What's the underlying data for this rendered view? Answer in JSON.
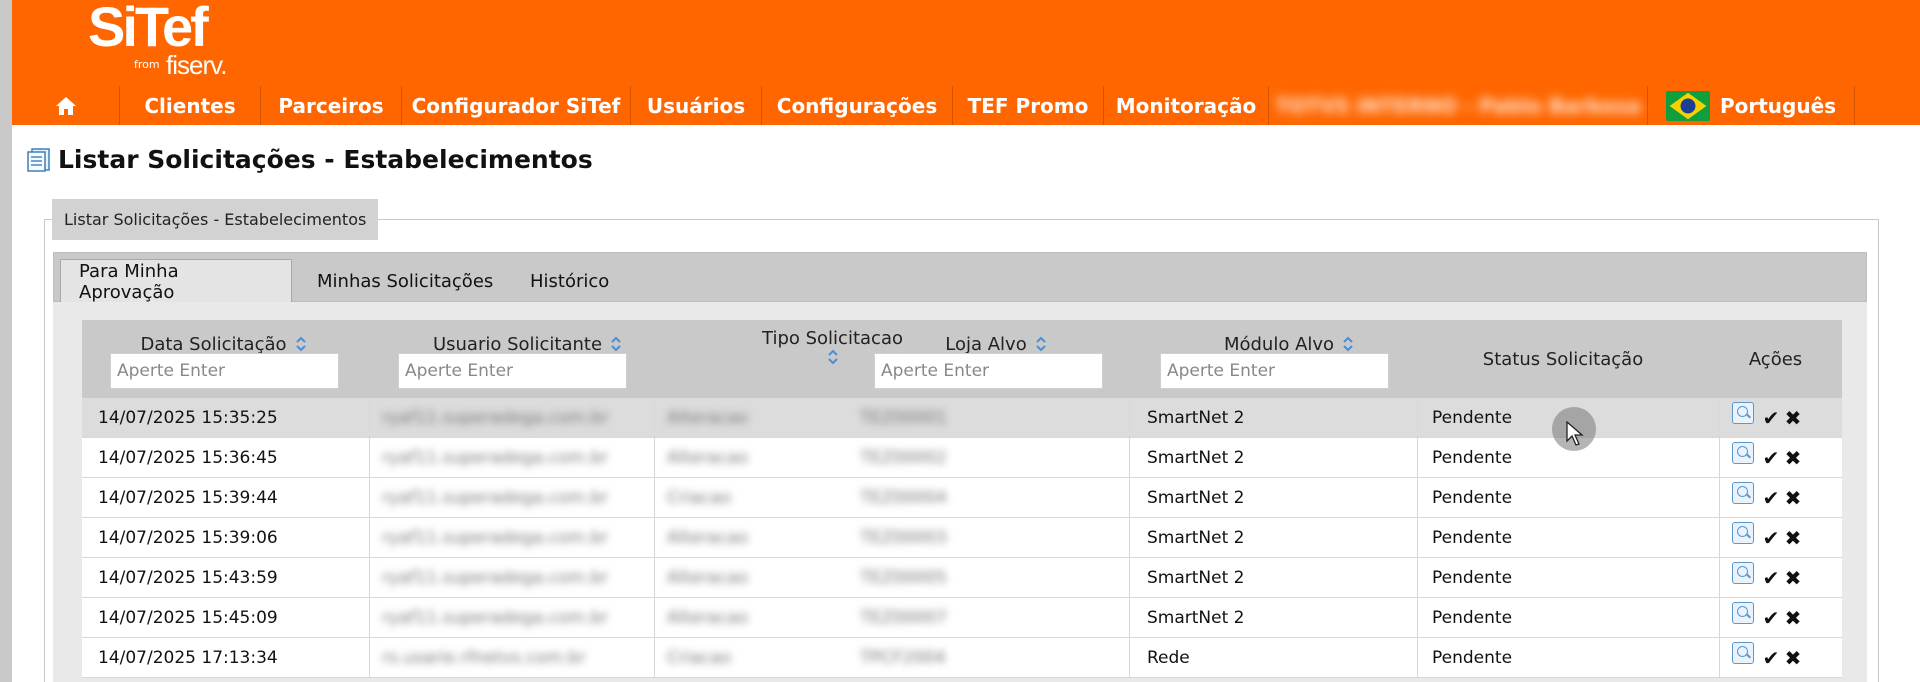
{
  "app": {
    "logo": {
      "name": "SiTef",
      "from": "from",
      "brand": "fiserv."
    },
    "accent_color": "#ff6600"
  },
  "nav": {
    "home_icon": "home-icon",
    "items": [
      "Clientes",
      "Parceiros",
      "Configurador SiTef",
      "Usuários",
      "Configurações",
      "TEF Promo",
      "Monitoração"
    ],
    "user": "TOTVS INTERNO - Pablo Barbosa",
    "language": "Português",
    "language_flag": "brazil-flag-icon"
  },
  "page": {
    "title": "Listar Solicitações - Estabelecimentos",
    "panel_legend": "Listar Solicitações - Estabelecimentos"
  },
  "tabs": [
    {
      "label": "Para Minha Aprovação",
      "active": true
    },
    {
      "label": "Minhas Solicitações",
      "active": false
    },
    {
      "label": "Histórico",
      "active": false
    }
  ],
  "table": {
    "columns": [
      {
        "label": "Data Solicitação",
        "placeholder": "Aperte Enter"
      },
      {
        "label": "Usuario Solicitante",
        "placeholder": "Aperte Enter"
      },
      {
        "label": "Tipo Solicitacao"
      },
      {
        "label": "Loja Alvo",
        "placeholder": "Aperte Enter"
      },
      {
        "label": "Módulo Alvo",
        "placeholder": "Aperte Enter"
      },
      {
        "label": "Status Solicitação"
      },
      {
        "label": "Ações"
      }
    ],
    "rows": [
      {
        "date": "14/07/2025 15:35:25",
        "user": "ryaf11.superadega.com.br",
        "type": "Alteracao",
        "store": "TEZ00001",
        "module": "SmartNet 2",
        "status": "Pendente"
      },
      {
        "date": "14/07/2025 15:36:45",
        "user": "ryaf11.superadega.com.br",
        "type": "Alteracao",
        "store": "TEZ00002",
        "module": "SmartNet 2",
        "status": "Pendente"
      },
      {
        "date": "14/07/2025 15:39:44",
        "user": "ryaf11.superadega.com.br",
        "type": "Criacao",
        "store": "TEZ00004",
        "module": "SmartNet 2",
        "status": "Pendente"
      },
      {
        "date": "14/07/2025 15:39:06",
        "user": "ryaf11.superadega.com.br",
        "type": "Alteracao",
        "store": "TEZ00003",
        "module": "SmartNet 2",
        "status": "Pendente"
      },
      {
        "date": "14/07/2025 15:43:59",
        "user": "ryaf11.superadega.com.br",
        "type": "Alteracao",
        "store": "TEZ00005",
        "module": "SmartNet 2",
        "status": "Pendente"
      },
      {
        "date": "14/07/2025 15:45:09",
        "user": "ryaf11.superadega.com.br",
        "type": "Alteracao",
        "store": "TEZ00007",
        "module": "SmartNet 2",
        "status": "Pendente"
      },
      {
        "date": "14/07/2025 17:13:34",
        "user": "rs.usarie.rfnetvs.com.br",
        "type": "Criacao",
        "store": "TPCF2004",
        "module": "Rede",
        "status": "Pendente"
      }
    ],
    "actions": {
      "view": "search-icon",
      "approve": "✔",
      "reject": "✖"
    }
  }
}
